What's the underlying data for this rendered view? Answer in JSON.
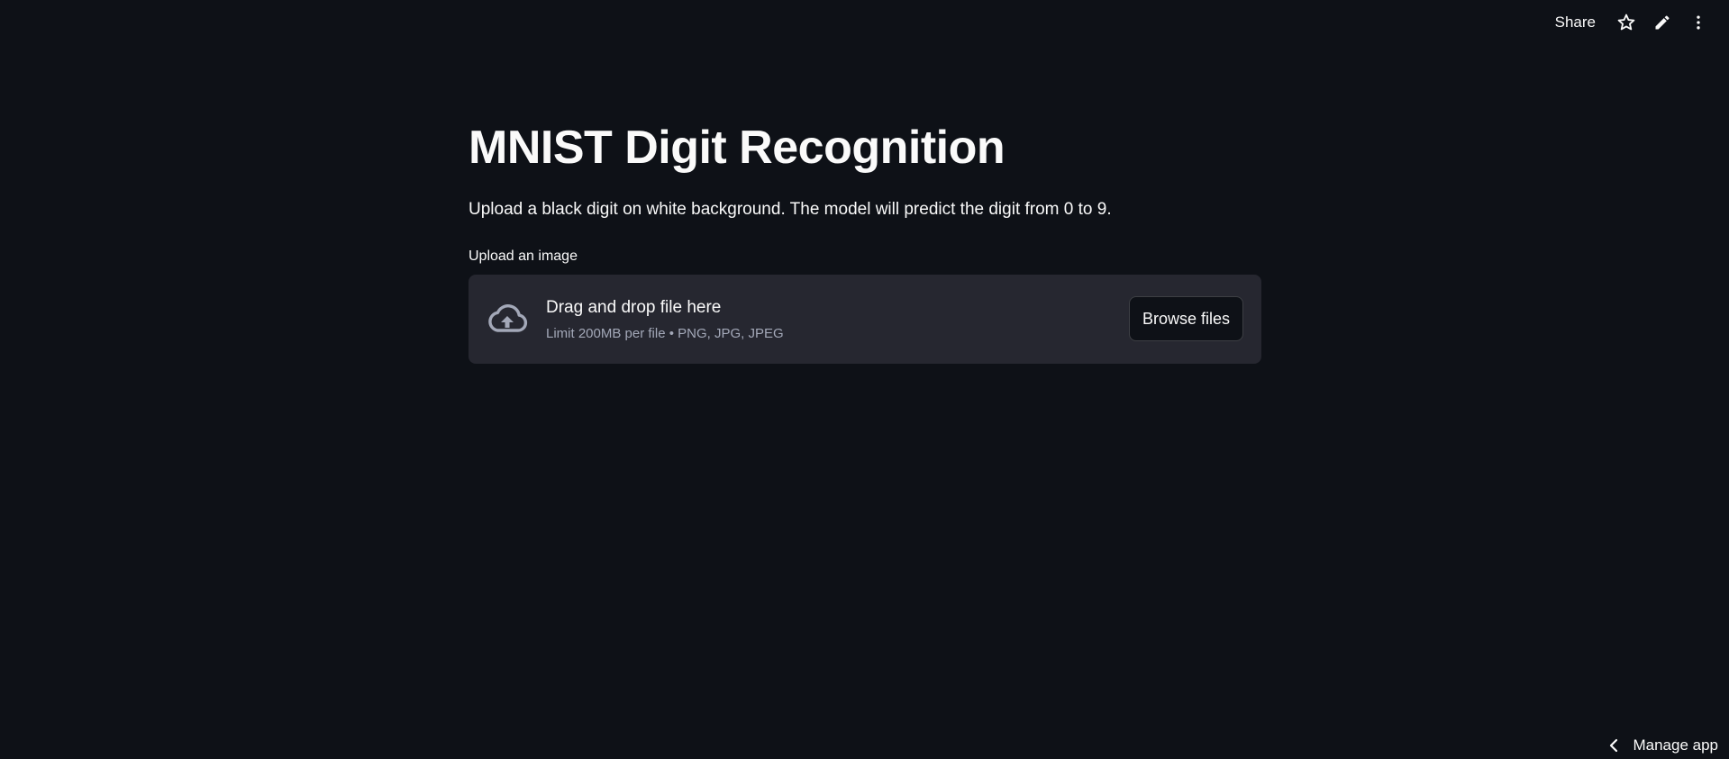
{
  "toolbar": {
    "share_label": "Share",
    "icons": [
      "star-icon",
      "pencil-icon",
      "more-vert-icon"
    ]
  },
  "main": {
    "title": "MNIST Digit Recognition",
    "subtitle": "Upload a black digit on white background. The model will predict the digit from 0 to 9.",
    "uploader": {
      "label": "Upload an image",
      "drop_text": "Drag and drop file here",
      "limit_text": "Limit 200MB per file • PNG, JPG, JPEG",
      "browse_label": "Browse files",
      "icon": "cloud-upload-icon"
    }
  },
  "footer": {
    "manage_label": "Manage app",
    "icon": "chevron-left-icon"
  },
  "colors": {
    "background": "#0e1117",
    "text": "#fafafa",
    "dropzone_bg": "#262730",
    "muted_text": "#a3a8b8"
  }
}
